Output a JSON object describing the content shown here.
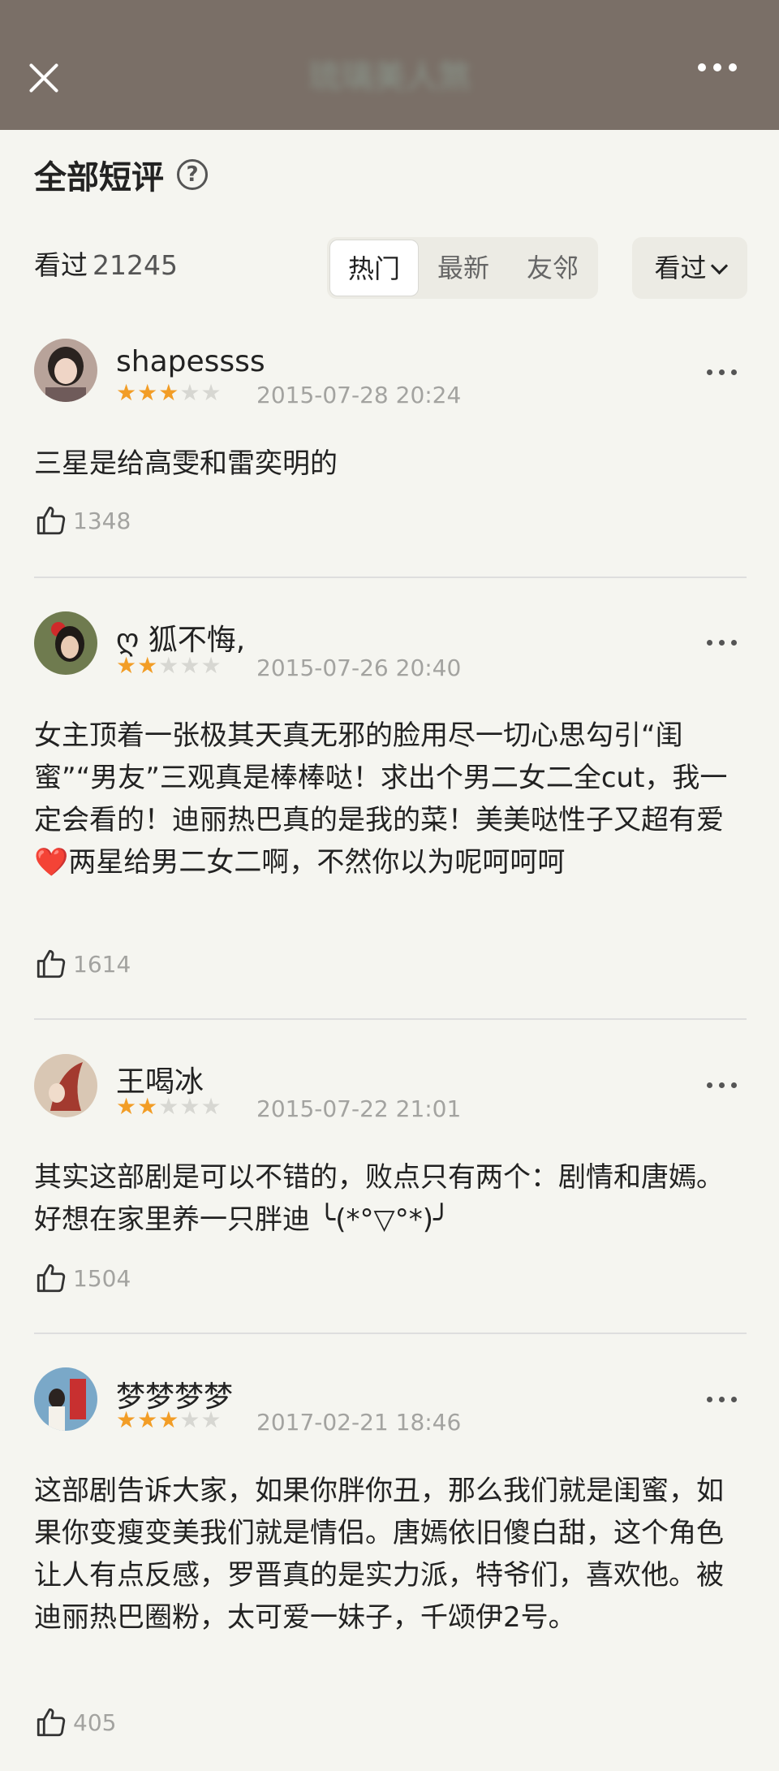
{
  "header": {
    "title": "琉璃美人煞",
    "close_icon": "close-icon",
    "more_icon": "more-horizontal-icon"
  },
  "section": {
    "title": "全部短评",
    "help_icon": "question-circle-icon"
  },
  "stats": {
    "watched_label": "看过",
    "watched_count": "21245"
  },
  "sort_tabs": [
    {
      "label": "热门",
      "active": true
    },
    {
      "label": "最新",
      "active": false
    },
    {
      "label": "友邻",
      "active": false
    }
  ],
  "filter": {
    "label": "看过",
    "icon": "chevron-down-icon"
  },
  "comments": [
    {
      "username": "shapessss",
      "rating": 3,
      "date": "2015-07-28 20:24",
      "content": "三星是给高雯和雷奕明的",
      "likes": "1348"
    },
    {
      "username": "ღ 狐不悔,",
      "rating": 2,
      "date": "2015-07-26 20:40",
      "content": "女主顶着一张极其天真无邪的脸用尽一切心思勾引“闺蜜”“男友”三观真是棒棒哒！求出个男二女二全cut，我一定会看的！迪丽热巴真的是我的菜！美美哒性子又超有爱❤️两星给男二女二啊，不然你以为呢呵呵呵",
      "likes": "1614"
    },
    {
      "username": "王喝冰",
      "rating": 2,
      "date": "2015-07-22 21:01",
      "content": "其实这部剧是可以不错的，败点只有两个：剧情和唐嫣。好想在家里养一只胖迪 ╰(*°▽°*)╯",
      "likes": "1504"
    },
    {
      "username": "梦梦梦梦",
      "rating": 3,
      "date": "2017-02-21 18:46",
      "content": "这部剧告诉大家，如果你胖你丑，那么我们就是闺蜜，如果你变瘦变美我们就是情侣。唐嫣依旧傻白甜，这个角色让人有点反感，罗晋真的是实力派，特爷们，喜欢他。被迪丽热巴圈粉，太可爱一妹子，千颂伊2号。",
      "likes": "405"
    }
  ],
  "colors": {
    "topbar": "#7a6f67",
    "star_on": "#f29d26",
    "star_off": "#d7d7d2",
    "background": "#f5f5f0"
  }
}
